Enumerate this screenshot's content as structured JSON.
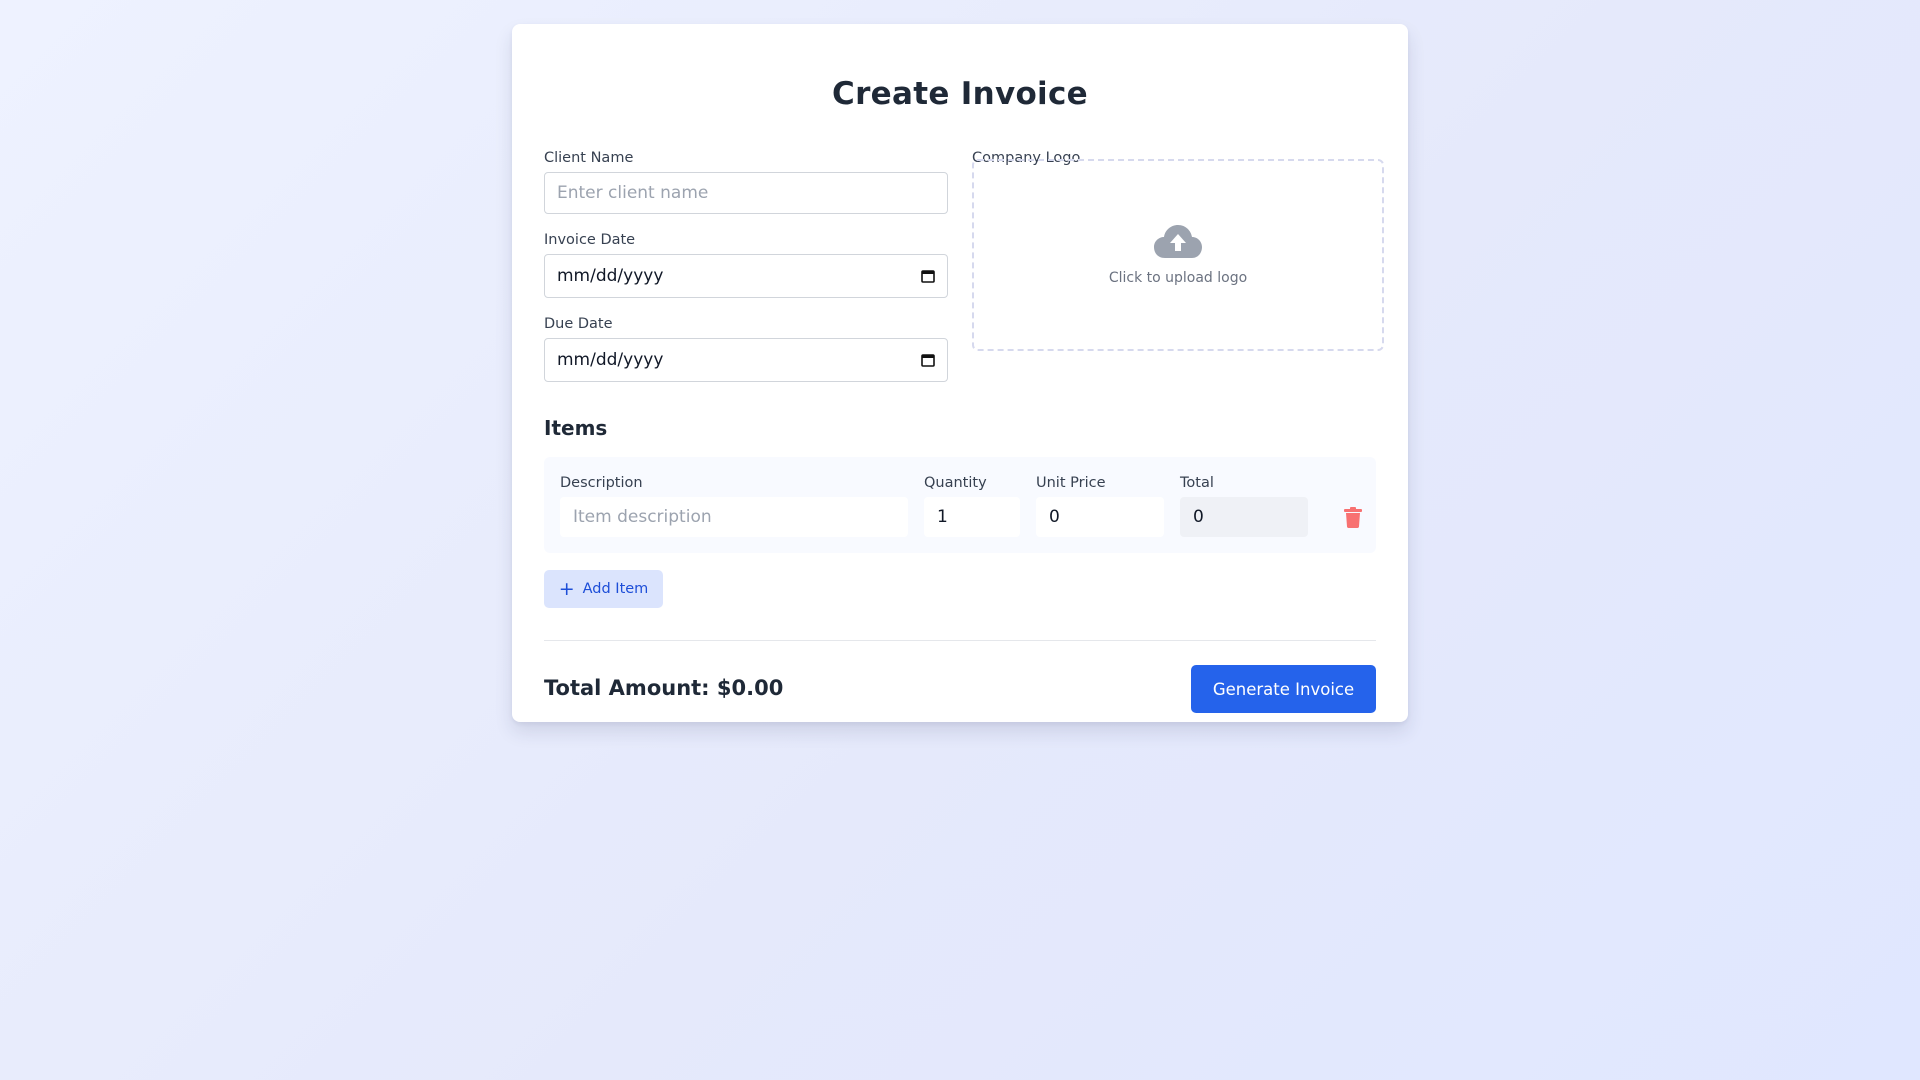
{
  "page": {
    "title": "Create Invoice"
  },
  "form": {
    "client_name": {
      "label": "Client Name",
      "placeholder": "Enter client name",
      "value": ""
    },
    "invoice_date": {
      "label": "Invoice Date",
      "value": "mm/dd/yyyy",
      "icon": "calendar-icon"
    },
    "due_date": {
      "label": "Due Date",
      "value": "mm/dd/yyyy",
      "icon": "calendar-icon"
    },
    "company_logo": {
      "label": "Company Logo",
      "hint": "Click to upload logo",
      "icon": "cloud-upload-icon"
    }
  },
  "items": {
    "section_title": "Items",
    "columns": {
      "description": "Description",
      "quantity": "Quantity",
      "unit_price": "Unit Price",
      "total": "Total"
    },
    "rows": [
      {
        "description_placeholder": "Item description",
        "description": "",
        "quantity": "1",
        "unit_price": "0",
        "total": "0",
        "delete_icon": "trash-icon"
      }
    ],
    "add_label": "Add Item",
    "add_icon": "plus-icon"
  },
  "footer": {
    "total_label": "Total Amount: $0.00",
    "generate_label": "Generate Invoice"
  },
  "colors": {
    "primary": "#2563eb",
    "add_button_bg": "#dbe4fd",
    "delete": "#f87171",
    "background": "#e8ecfd"
  }
}
